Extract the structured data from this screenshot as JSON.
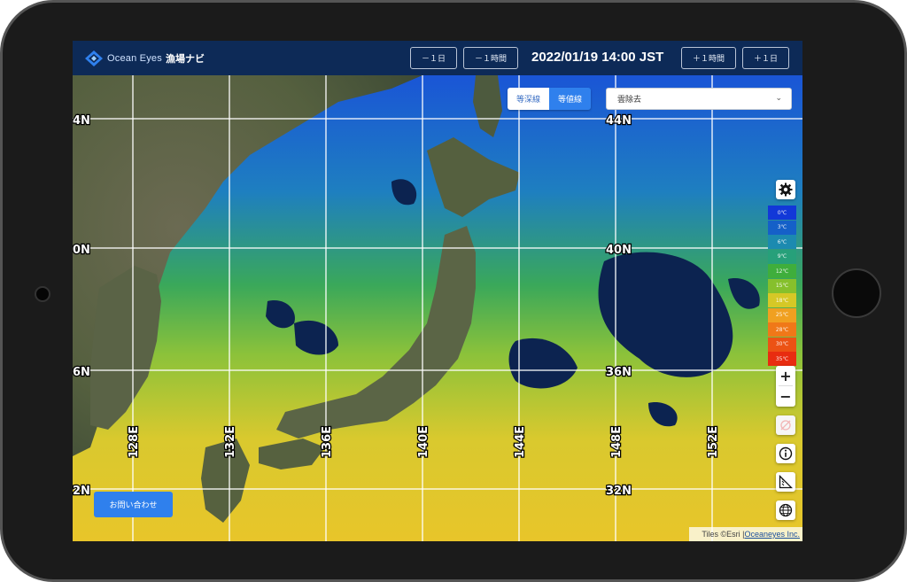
{
  "header": {
    "logo_text": "Ocean Eyes",
    "app_name": "漁場ナビ",
    "minus_day": "－１日",
    "minus_hour": "－１時間",
    "datetime": "2022/01/19 14:00 JST",
    "plus_hour": "＋１時間",
    "plus_day": "＋１日"
  },
  "overlay_toggle": {
    "depth": "等深線",
    "isotherm": "等値線"
  },
  "cloud_select": {
    "value": "雲除去"
  },
  "graticule": {
    "lat_labels": [
      "4N",
      "0N",
      "6N",
      "2N",
      "44N",
      "40N",
      "36N",
      "32N"
    ],
    "lon_labels": [
      "128E",
      "132E",
      "136E",
      "140E",
      "144E",
      "148E",
      "152E"
    ]
  },
  "legend": {
    "labels": [
      "0℃",
      "3℃",
      "6℃",
      "9℃",
      "12℃",
      "15℃",
      "18℃",
      "25℃",
      "28℃",
      "30℃",
      "35℃"
    ],
    "colors": [
      "#1238d8",
      "#1560c8",
      "#1c8ab0",
      "#27a07a",
      "#3fae3c",
      "#86c02c",
      "#d6c826",
      "#f0a020",
      "#f07818",
      "#ec5214",
      "#e82c10"
    ]
  },
  "controls": {
    "settings_icon": "gear-icon",
    "zoom_in": "+",
    "zoom_out": "−",
    "info_icon": "info-icon",
    "ruler_icon": "ruler-icon",
    "globe_icon": "globe-icon",
    "no_location_icon": "location-off-icon"
  },
  "contact_button": "お問い合わせ",
  "attribution": {
    "tiles": "Tiles ©Esri | ",
    "company": "Oceaneyes Inc."
  }
}
